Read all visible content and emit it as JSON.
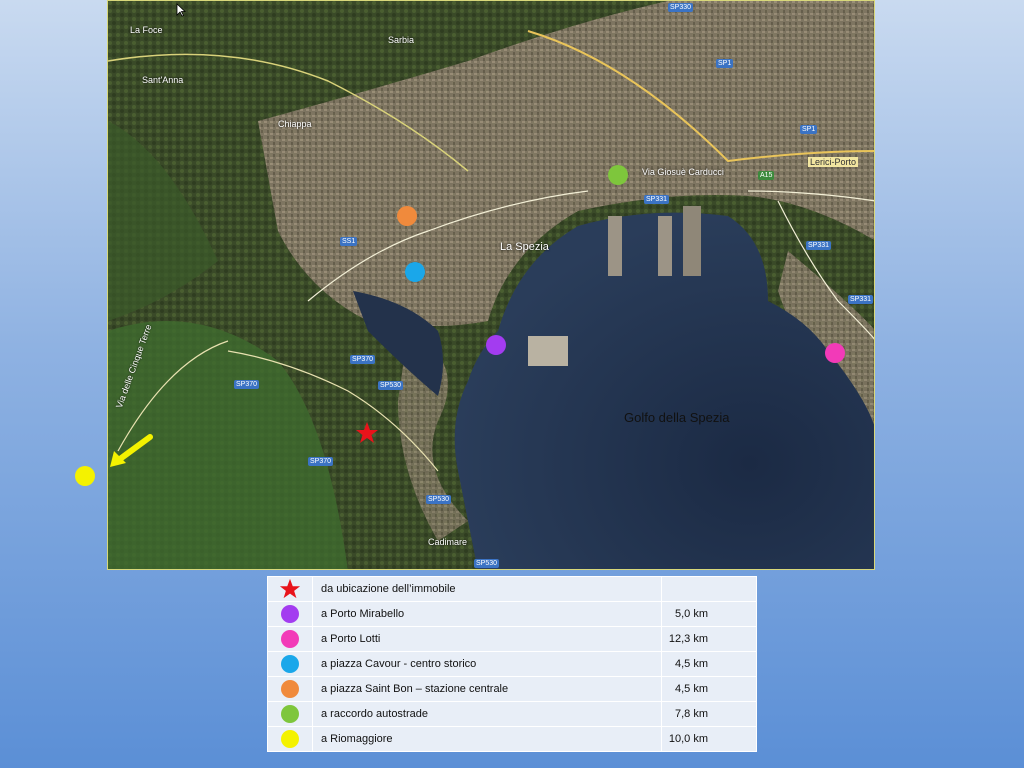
{
  "map": {
    "gulf_label": "Golfo della Spezia",
    "city_label": "La Spezia",
    "place_labels": [
      "La Foce",
      "Sant'Anna",
      "Sarbia",
      "Chiappa",
      "Cadimare",
      "Lerici-Porto",
      "Via Giosuè Carducci",
      "Via delle Cinque Terre"
    ],
    "road_shields": [
      "SP330",
      "SP1",
      "SP1",
      "SS1",
      "SP331",
      "SP331",
      "SP331",
      "SP370",
      "SP370",
      "SP370",
      "SP530",
      "SP530",
      "SP530",
      "A15"
    ],
    "markers": [
      {
        "name": "star",
        "color": "#e8131b"
      },
      {
        "name": "porto-mirabello",
        "color": "#a33cf0"
      },
      {
        "name": "porto-lotti",
        "color": "#f23ab8"
      },
      {
        "name": "piazza-cavour",
        "color": "#1aa7ea"
      },
      {
        "name": "piazza-saint-bon",
        "color": "#f08a3c"
      },
      {
        "name": "raccordo-autostrade",
        "color": "#7ec63c"
      },
      {
        "name": "riomaggiore",
        "color": "#f4f200"
      }
    ],
    "arrow_color": "#f4f200"
  },
  "legend": [
    {
      "icon": "red-star",
      "color": "#e8131b",
      "label": "da ubicazione dell’immobile",
      "distance": ""
    },
    {
      "icon": "purple-dot",
      "color": "#a33cf0",
      "label": "a Porto Mirabello",
      "distance": "5,0 km"
    },
    {
      "icon": "magenta-dot",
      "color": "#f23ab8",
      "label": "a Porto Lotti",
      "distance": "12,3 km"
    },
    {
      "icon": "cyan-dot",
      "color": "#1aa7ea",
      "label": "a piazza Cavour  - centro storico",
      "distance": "4,5 km"
    },
    {
      "icon": "orange-dot",
      "color": "#f08a3c",
      "label": "a piazza Saint Bon – stazione centrale",
      "distance": "4,5 km"
    },
    {
      "icon": "green-dot",
      "color": "#7ec63c",
      "label": "a raccordo autostrade",
      "distance": "7,8 km"
    },
    {
      "icon": "yellow-dot",
      "color": "#f4f200",
      "label": "a Riomaggiore",
      "distance": "10,0 km"
    }
  ]
}
